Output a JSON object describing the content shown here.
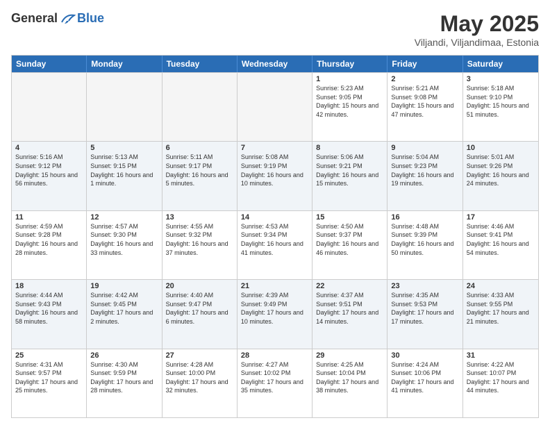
{
  "header": {
    "logo_general": "General",
    "logo_blue": "Blue",
    "month_title": "May 2025",
    "location": "Viljandi, Viljandimaa, Estonia"
  },
  "weekdays": [
    "Sunday",
    "Monday",
    "Tuesday",
    "Wednesday",
    "Thursday",
    "Friday",
    "Saturday"
  ],
  "rows": [
    [
      {
        "day": "",
        "info": "",
        "empty": true
      },
      {
        "day": "",
        "info": "",
        "empty": true
      },
      {
        "day": "",
        "info": "",
        "empty": true
      },
      {
        "day": "",
        "info": "",
        "empty": true
      },
      {
        "day": "1",
        "info": "Sunrise: 5:23 AM\nSunset: 9:05 PM\nDaylight: 15 hours and 42 minutes."
      },
      {
        "day": "2",
        "info": "Sunrise: 5:21 AM\nSunset: 9:08 PM\nDaylight: 15 hours and 47 minutes."
      },
      {
        "day": "3",
        "info": "Sunrise: 5:18 AM\nSunset: 9:10 PM\nDaylight: 15 hours and 51 minutes."
      }
    ],
    [
      {
        "day": "4",
        "info": "Sunrise: 5:16 AM\nSunset: 9:12 PM\nDaylight: 15 hours and 56 minutes."
      },
      {
        "day": "5",
        "info": "Sunrise: 5:13 AM\nSunset: 9:15 PM\nDaylight: 16 hours and 1 minute."
      },
      {
        "day": "6",
        "info": "Sunrise: 5:11 AM\nSunset: 9:17 PM\nDaylight: 16 hours and 5 minutes."
      },
      {
        "day": "7",
        "info": "Sunrise: 5:08 AM\nSunset: 9:19 PM\nDaylight: 16 hours and 10 minutes."
      },
      {
        "day": "8",
        "info": "Sunrise: 5:06 AM\nSunset: 9:21 PM\nDaylight: 16 hours and 15 minutes."
      },
      {
        "day": "9",
        "info": "Sunrise: 5:04 AM\nSunset: 9:23 PM\nDaylight: 16 hours and 19 minutes."
      },
      {
        "day": "10",
        "info": "Sunrise: 5:01 AM\nSunset: 9:26 PM\nDaylight: 16 hours and 24 minutes."
      }
    ],
    [
      {
        "day": "11",
        "info": "Sunrise: 4:59 AM\nSunset: 9:28 PM\nDaylight: 16 hours and 28 minutes."
      },
      {
        "day": "12",
        "info": "Sunrise: 4:57 AM\nSunset: 9:30 PM\nDaylight: 16 hours and 33 minutes."
      },
      {
        "day": "13",
        "info": "Sunrise: 4:55 AM\nSunset: 9:32 PM\nDaylight: 16 hours and 37 minutes."
      },
      {
        "day": "14",
        "info": "Sunrise: 4:53 AM\nSunset: 9:34 PM\nDaylight: 16 hours and 41 minutes."
      },
      {
        "day": "15",
        "info": "Sunrise: 4:50 AM\nSunset: 9:37 PM\nDaylight: 16 hours and 46 minutes."
      },
      {
        "day": "16",
        "info": "Sunrise: 4:48 AM\nSunset: 9:39 PM\nDaylight: 16 hours and 50 minutes."
      },
      {
        "day": "17",
        "info": "Sunrise: 4:46 AM\nSunset: 9:41 PM\nDaylight: 16 hours and 54 minutes."
      }
    ],
    [
      {
        "day": "18",
        "info": "Sunrise: 4:44 AM\nSunset: 9:43 PM\nDaylight: 16 hours and 58 minutes."
      },
      {
        "day": "19",
        "info": "Sunrise: 4:42 AM\nSunset: 9:45 PM\nDaylight: 17 hours and 2 minutes."
      },
      {
        "day": "20",
        "info": "Sunrise: 4:40 AM\nSunset: 9:47 PM\nDaylight: 17 hours and 6 minutes."
      },
      {
        "day": "21",
        "info": "Sunrise: 4:39 AM\nSunset: 9:49 PM\nDaylight: 17 hours and 10 minutes."
      },
      {
        "day": "22",
        "info": "Sunrise: 4:37 AM\nSunset: 9:51 PM\nDaylight: 17 hours and 14 minutes."
      },
      {
        "day": "23",
        "info": "Sunrise: 4:35 AM\nSunset: 9:53 PM\nDaylight: 17 hours and 17 minutes."
      },
      {
        "day": "24",
        "info": "Sunrise: 4:33 AM\nSunset: 9:55 PM\nDaylight: 17 hours and 21 minutes."
      }
    ],
    [
      {
        "day": "25",
        "info": "Sunrise: 4:31 AM\nSunset: 9:57 PM\nDaylight: 17 hours and 25 minutes."
      },
      {
        "day": "26",
        "info": "Sunrise: 4:30 AM\nSunset: 9:59 PM\nDaylight: 17 hours and 28 minutes."
      },
      {
        "day": "27",
        "info": "Sunrise: 4:28 AM\nSunset: 10:00 PM\nDaylight: 17 hours and 32 minutes."
      },
      {
        "day": "28",
        "info": "Sunrise: 4:27 AM\nSunset: 10:02 PM\nDaylight: 17 hours and 35 minutes."
      },
      {
        "day": "29",
        "info": "Sunrise: 4:25 AM\nSunset: 10:04 PM\nDaylight: 17 hours and 38 minutes."
      },
      {
        "day": "30",
        "info": "Sunrise: 4:24 AM\nSunset: 10:06 PM\nDaylight: 17 hours and 41 minutes."
      },
      {
        "day": "31",
        "info": "Sunrise: 4:22 AM\nSunset: 10:07 PM\nDaylight: 17 hours and 44 minutes."
      }
    ]
  ]
}
